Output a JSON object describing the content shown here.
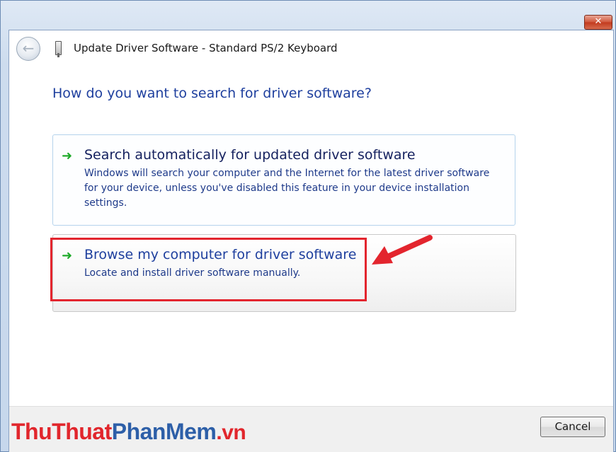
{
  "window": {
    "title": "Update Driver Software - Standard PS/2 Keyboard",
    "close_label": "✕"
  },
  "content": {
    "heading": "How do you want to search for driver software?"
  },
  "options": [
    {
      "title": "Search automatically for updated driver software",
      "description_lines": [
        "Windows will search your computer and the Internet for the latest driver software",
        "for your device, unless you've disabled this feature in your device installation",
        "settings."
      ]
    },
    {
      "title": "Browse my computer for driver software",
      "description_lines": [
        "Locate and install driver software manually."
      ]
    }
  ],
  "footer": {
    "cancel_label": "Cancel"
  },
  "watermark": {
    "part1": "ThuThuat",
    "part2": "PhanMem",
    "part3": ".vn"
  },
  "icons": {
    "back": "back-arrow-icon",
    "device": "keyboard-device-icon",
    "option_arrow": "green-arrow-icon"
  },
  "colors": {
    "heading": "#1e3f9e",
    "option_arrow": "#1faa2a",
    "highlight": "#e3252e",
    "watermark_red": "#e1262c",
    "watermark_blue": "#2d5fa8"
  }
}
